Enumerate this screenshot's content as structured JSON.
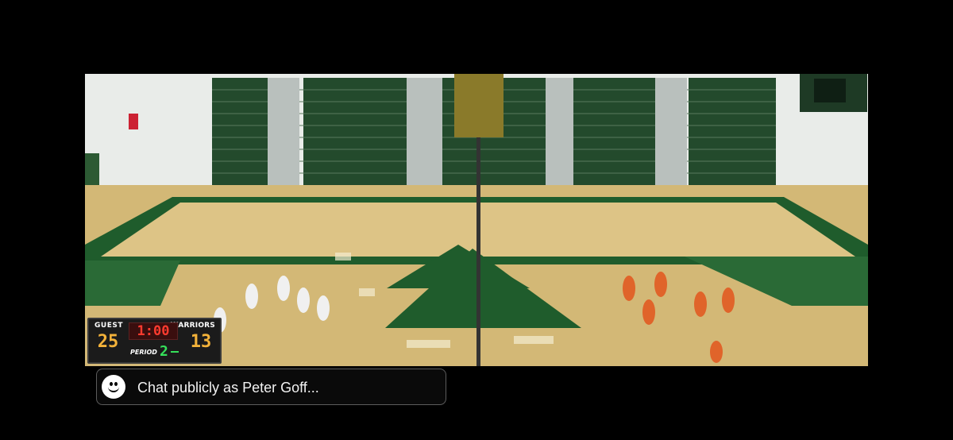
{
  "stream": {
    "scoreboard": {
      "guest_label": "GUEST",
      "home_label": "WARRIORS",
      "guest_score": "25",
      "home_score": "13",
      "clock": "1:00",
      "period_label": "PERIOD",
      "period": "2"
    }
  },
  "chat": {
    "placeholder": "Chat publicly as Peter Goff...",
    "emoji_icon": "smiley-face-icon"
  },
  "colors": {
    "court_green": "#1f5c2c",
    "court_wood": "#d8bf7a",
    "clock_red": "#ff3b2f",
    "score_amber": "#f3b23a",
    "period_green": "#35e05a"
  }
}
